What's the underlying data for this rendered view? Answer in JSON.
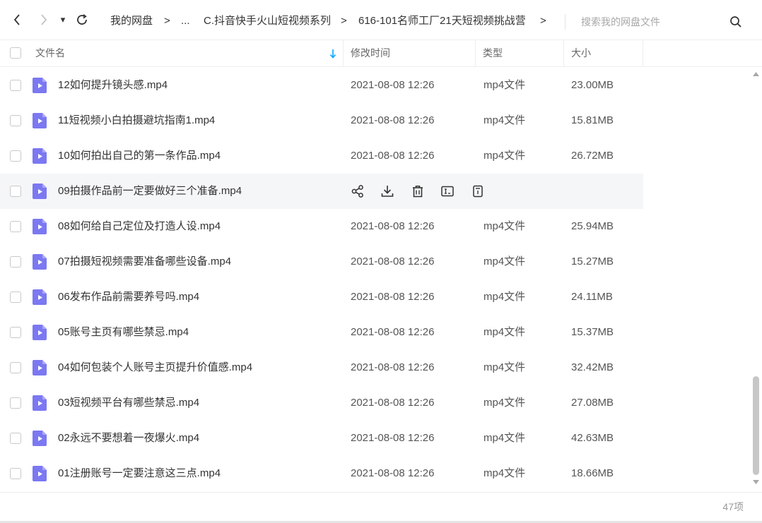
{
  "nav": {
    "dropdown_glyph": "▾"
  },
  "breadcrumb": {
    "items": [
      "我的网盘",
      "...",
      "C.抖音快手火山短视频系列",
      "616-101名师工厂21天短视频挑战营"
    ],
    "separator": ">"
  },
  "search": {
    "placeholder": "搜索我的网盘文件"
  },
  "columns": {
    "name": "文件名",
    "modified": "修改时间",
    "type": "类型",
    "size": "大小"
  },
  "files": [
    {
      "name": "12如何提升镜头感.mp4",
      "modified": "2021-08-08 12:26",
      "type": "mp4文件",
      "size": "23.00MB"
    },
    {
      "name": "11短视频小白拍摄避坑指南1.mp4",
      "modified": "2021-08-08 12:26",
      "type": "mp4文件",
      "size": "15.81MB"
    },
    {
      "name": "10如何拍出自己的第一条作品.mp4",
      "modified": "2021-08-08 12:26",
      "type": "mp4文件",
      "size": "26.72MB"
    },
    {
      "name": "09拍摄作品前一定要做好三个准备.mp4",
      "modified": "",
      "type": "",
      "size": ""
    },
    {
      "name": "08如何给自己定位及打造人设.mp4",
      "modified": "2021-08-08 12:26",
      "type": "mp4文件",
      "size": "25.94MB"
    },
    {
      "name": "07拍摄短视频需要准备哪些设备.mp4",
      "modified": "2021-08-08 12:26",
      "type": "mp4文件",
      "size": "15.27MB"
    },
    {
      "name": "06发布作品前需要养号吗.mp4",
      "modified": "2021-08-08 12:26",
      "type": "mp4文件",
      "size": "24.11MB"
    },
    {
      "name": "05账号主页有哪些禁忌.mp4",
      "modified": "2021-08-08 12:26",
      "type": "mp4文件",
      "size": "15.37MB"
    },
    {
      "name": "04如何包装个人账号主页提升价值感.mp4",
      "modified": "2021-08-08 12:26",
      "type": "mp4文件",
      "size": "32.42MB"
    },
    {
      "name": "03短视频平台有哪些禁忌.mp4",
      "modified": "2021-08-08 12:26",
      "type": "mp4文件",
      "size": "27.08MB"
    },
    {
      "name": "02永远不要想着一夜爆火.mp4",
      "modified": "2021-08-08 12:26",
      "type": "mp4文件",
      "size": "42.63MB"
    },
    {
      "name": "01注册账号一定要注意这三点.mp4",
      "modified": "2021-08-08 12:26",
      "type": "mp4文件",
      "size": "18.66MB"
    }
  ],
  "hover_row_index": 3,
  "hover_actions": [
    "share-icon",
    "download-icon",
    "delete-icon",
    "rename-icon",
    "more-icon"
  ],
  "footer": {
    "count": "47项"
  },
  "colors": {
    "accent": "#06a7ff",
    "file_icon": "#7b78f2",
    "hover_bg": "#f5f6f8"
  }
}
